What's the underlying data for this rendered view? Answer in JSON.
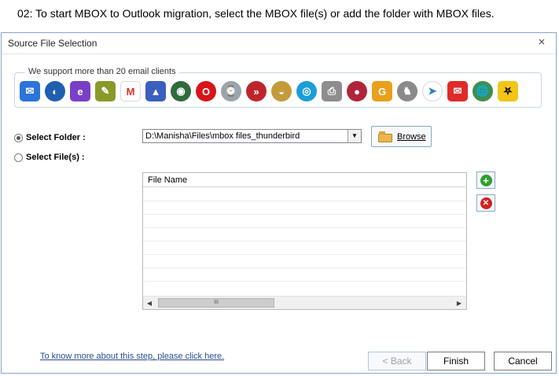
{
  "caption": "02:  To start MBOX to Outlook migration, select the MBOX file(s) or add the folder with MBOX files.",
  "dialog": {
    "title": "Source File Selection",
    "close_glyph": "×"
  },
  "clients": {
    "legend": "We support more than 20 email clients",
    "icons": [
      {
        "name": "mail-envelope-icon",
        "glyph": "✉",
        "bg": "#2b74d8",
        "shape": "sq"
      },
      {
        "name": "thunderbird-icon",
        "glyph": "◐",
        "bg": "#1f5fb0",
        "shape": "round"
      },
      {
        "name": "entourage-icon",
        "glyph": "e",
        "bg": "#7a3fc7",
        "shape": "sq"
      },
      {
        "name": "pencil-mail-icon",
        "glyph": "✎",
        "bg": "#8a9a2a",
        "shape": "sq"
      },
      {
        "name": "gmail-icon",
        "glyph": "M",
        "bg": "#ffffff",
        "fg": "#d93025",
        "shape": "sq"
      },
      {
        "name": "postbox-icon",
        "glyph": "▲",
        "bg": "#3a5fbf",
        "shape": "sq"
      },
      {
        "name": "seamonkey-icon",
        "glyph": "◉",
        "bg": "#2f6b3a",
        "shape": "round"
      },
      {
        "name": "opera-icon",
        "glyph": "O",
        "bg": "#d7141a",
        "shape": "round"
      },
      {
        "name": "clock-mail-icon",
        "glyph": "⌚",
        "bg": "#9aa4ad",
        "shape": "round"
      },
      {
        "name": "arrow-right-icon",
        "glyph": "»",
        "bg": "#c0242b",
        "shape": "round"
      },
      {
        "name": "eudora-icon",
        "glyph": "◒",
        "bg": "#c59b3a",
        "shape": "round"
      },
      {
        "name": "spicebird-icon",
        "glyph": "◎",
        "bg": "#1b9ed8",
        "shape": "round"
      },
      {
        "name": "scanner-icon",
        "glyph": "⎙",
        "bg": "#8d8d8d",
        "shape": "sq"
      },
      {
        "name": "berries-icon",
        "glyph": "●",
        "bg": "#b0243a",
        "shape": "round"
      },
      {
        "name": "g-mail-icon",
        "glyph": "G",
        "bg": "#e8a11c",
        "shape": "sq"
      },
      {
        "name": "gnu-icon",
        "glyph": "♞",
        "bg": "#8a8a8a",
        "shape": "round"
      },
      {
        "name": "paper-plane-icon",
        "glyph": "➤",
        "bg": "#ffffff",
        "fg": "#2a7fc4",
        "shape": "round"
      },
      {
        "name": "red-envelope-icon",
        "glyph": "✉",
        "bg": "#e02a2a",
        "shape": "sq"
      },
      {
        "name": "globe-mail-icon",
        "glyph": "🌐",
        "bg": "#3f8f4f",
        "shape": "round"
      },
      {
        "name": "bat-icon",
        "glyph": "⛧",
        "bg": "#f2c519",
        "fg": "#000",
        "shape": "sq"
      }
    ]
  },
  "form": {
    "select_folder_label": "Select Folder :",
    "select_files_label": "Select File(s) :",
    "folder_path": "D:\\Manisha\\Files\\mbox files_thunderbird",
    "browse_label": "Browse"
  },
  "file_table": {
    "column_header": "File Name",
    "scroll_thumb_glyph": "III"
  },
  "footer": {
    "help_link": "To know more about this step, please click here.",
    "back_label": "< Back",
    "finish_label": "Finish",
    "cancel_label": "Cancel"
  }
}
